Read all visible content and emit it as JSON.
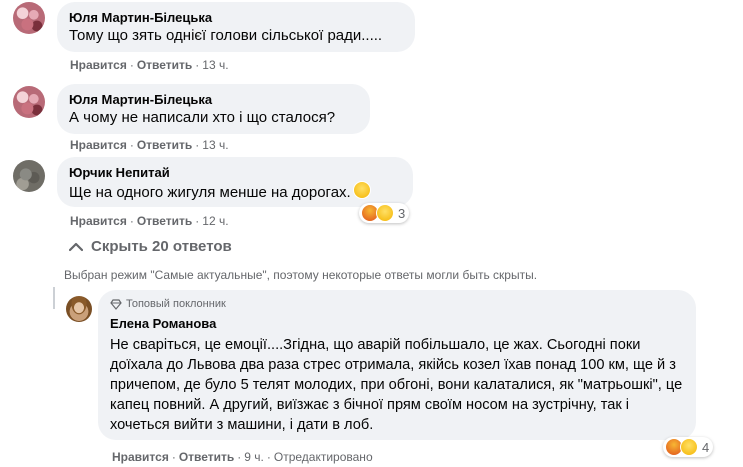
{
  "comments": [
    {
      "author": "Юля Мартин-Білецька",
      "text": "Тому що зять однієї голови сільської ради.....",
      "like": "Нравится",
      "reply": "Ответить",
      "time": "13 ч."
    },
    {
      "author": "Юля Мартин-Білецька",
      "text": "А чому не написали хто і що сталося?",
      "like": "Нравится",
      "reply": "Ответить",
      "time": "13 ч."
    },
    {
      "author": "Юрчик Непитай",
      "text": "Ще на одного жигуля менше на дорогах.",
      "like": "Нравится",
      "reply": "Ответить",
      "time": "12 ч.",
      "reactions_count": "3"
    }
  ],
  "hide_replies_label": "Скрыть 20 ответов",
  "mode_note": "Выбран режим \"Самые актуальные\", поэтому некоторые ответы могли быть скрыты.",
  "reply": {
    "badge": "Топовый поклонник",
    "author": "Елена Романова",
    "text": "Не сваріться, це емоції....Згідна, що аварій побільшало, це жах. Сьогодні поки доїхала до Львова два раза стрес отримала, якійсь козел їхав понад 100 км, ще й з причепом, де було 5 телят молодих, при обгоні, вони калаталися, як \"матрьошкі\", це капец повний. А другий, виїзжає з бічної прям своїм носом на зустрічну, так і хочеться вийти з машини, і дати в лоб.",
    "like": "Нравится",
    "reply": "Ответить",
    "time": "9 ч.",
    "edited": "Отредактировано",
    "reactions_count": "4"
  },
  "icons": {
    "reactions": [
      "angry-icon",
      "laugh-icon"
    ],
    "badge": "diamond-icon",
    "hide": "chevron-up-icon"
  }
}
